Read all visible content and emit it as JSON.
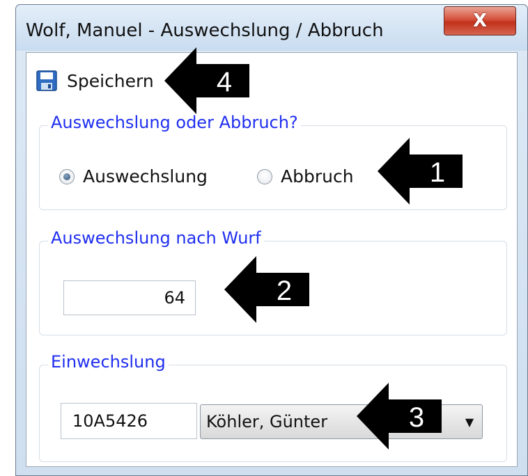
{
  "window": {
    "title": "Wolf, Manuel - Auswechslung / Abbruch",
    "close_glyph": "X"
  },
  "toolbar": {
    "save_label": "Speichern",
    "save_icon": "floppy-disk-icon"
  },
  "group_type": {
    "legend": "Auswechslung oder Abbruch?",
    "options": [
      {
        "label": "Auswechslung",
        "checked": true
      },
      {
        "label": "Abbruch",
        "checked": false
      }
    ]
  },
  "group_throw": {
    "legend": "Auswechslung nach Wurf",
    "value": "64"
  },
  "group_sub_in": {
    "legend": "Einwechslung",
    "player_id": "10A5426",
    "player_name": "Köhler, Günter",
    "dropdown_icon": "chevron-down-icon"
  },
  "annotations": [
    {
      "number": "1",
      "target": "radio-options"
    },
    {
      "number": "2",
      "target": "throw-input"
    },
    {
      "number": "3",
      "target": "player-dropdown"
    },
    {
      "number": "4",
      "target": "save-button"
    }
  ],
  "colors": {
    "legend_text": "#1f2ef0",
    "close_button": "#c1311a",
    "callout": "#000000",
    "callout_text": "#ffffff"
  }
}
